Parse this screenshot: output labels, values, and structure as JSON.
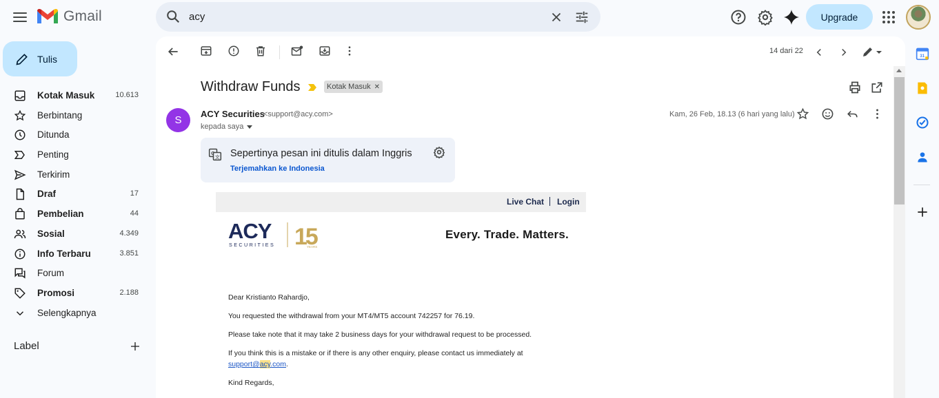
{
  "header": {
    "app_name": "Gmail",
    "search_value": "acy",
    "upgrade_label": "Upgrade"
  },
  "compose_label": "Tulis",
  "nav": [
    {
      "label": "Kotak Masuk",
      "count": "10.613",
      "bold": true,
      "icon": "inbox-icon"
    },
    {
      "label": "Berbintang",
      "count": "",
      "bold": false,
      "icon": "star-icon"
    },
    {
      "label": "Ditunda",
      "count": "",
      "bold": false,
      "icon": "clock-icon"
    },
    {
      "label": "Penting",
      "count": "",
      "bold": false,
      "icon": "important-icon"
    },
    {
      "label": "Terkirim",
      "count": "",
      "bold": false,
      "icon": "send-icon"
    },
    {
      "label": "Draf",
      "count": "17",
      "bold": true,
      "icon": "draft-icon"
    },
    {
      "label": "Pembelian",
      "count": "44",
      "bold": true,
      "icon": "bag-icon"
    },
    {
      "label": "Sosial",
      "count": "4.349",
      "bold": true,
      "icon": "people-icon"
    },
    {
      "label": "Info Terbaru",
      "count": "3.851",
      "bold": true,
      "icon": "info-icon"
    },
    {
      "label": "Forum",
      "count": "",
      "bold": false,
      "icon": "forum-icon"
    },
    {
      "label": "Promosi",
      "count": "2.188",
      "bold": true,
      "icon": "tag-icon"
    },
    {
      "label": "Selengkapnya",
      "count": "",
      "bold": false,
      "icon": "chevron-down-icon"
    }
  ],
  "labels_header": "Label",
  "toolbar": {
    "pager": "14 dari 22"
  },
  "message": {
    "subject": "Withdraw Funds",
    "label_chip": "Kotak Masuk",
    "sender_initial": "S",
    "sender_name": "ACY Securities",
    "sender_email": "<support@acy.com>",
    "to": "kepada saya",
    "date": "Kam, 26 Feb, 18.13 (6 hari yang lalu)"
  },
  "translate": {
    "title": "Sepertinya pesan ini ditulis dalam Inggris",
    "link": "Terjemahkan ke Indonesia"
  },
  "email": {
    "live_chat": "Live Chat",
    "login": "Login",
    "logo_word": "ACY",
    "logo_sub": "SECURITIES",
    "logo_years_num": "15",
    "logo_years": "YEARS",
    "tagline": "Every. Trade. Matters.",
    "greeting": "Dear Kristianto Rahardjo,",
    "p1": "You requested the withdrawal from your MT4/MT5 account 742257 for 76.19.",
    "p2": "Please take note that it may take 2 business days for your withdrawal request to be processed.",
    "p3": "If you think this is a mistake or if there is any other enquiry, please contact us immediately at",
    "link_pre": "support@",
    "link_hl": "acy",
    "link_post": ".com",
    "link_after": ".",
    "closing": "Kind Regards,"
  }
}
